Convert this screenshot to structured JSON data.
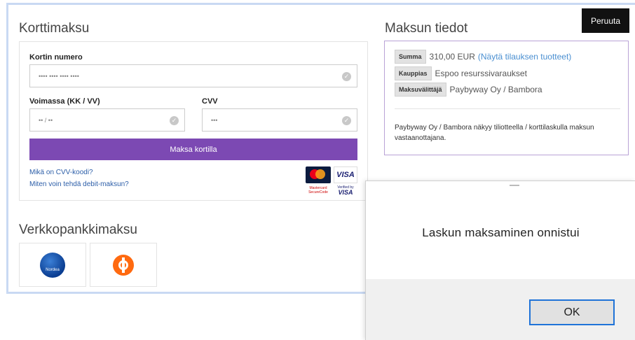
{
  "header": {
    "cancel_label": "Peruuta"
  },
  "card_payment": {
    "title": "Korttimaksu",
    "card_number_label": "Kortin numero",
    "card_number_placeholder": "•••• •••• •••• ••••",
    "expiry_label": "Voimassa (KK / VV)",
    "expiry_placeholder": "•• / ••",
    "cvv_label": "CVV",
    "cvv_placeholder": "•••",
    "pay_button": "Maksa kortilla",
    "link_cvv": "Mikä on CVV-koodi?",
    "link_debit": "Miten voin tehdä debit-maksun?",
    "logos": {
      "mastercard": "mastercard",
      "visa": "VISA",
      "mastercard_securecode": "Mastercard SecureCode",
      "verified_by": "Verified by",
      "verified_visa": "VISA"
    }
  },
  "bank_payment": {
    "title": "Verkkopankkimaksu",
    "banks": [
      {
        "name": "Nordea",
        "icon": "nordea-logo"
      },
      {
        "name": "OP",
        "icon": "op-logo"
      }
    ]
  },
  "payment_info": {
    "title": "Maksun tiedot",
    "sum_label": "Summa",
    "sum_value": "310,00 EUR",
    "sum_link": "(Näytä tilauksen tuotteet)",
    "merchant_label": "Kauppias",
    "merchant_value": "Espoo resurssivaraukset",
    "provider_label": "Maksuvälittäjä",
    "provider_value": "Paybyway Oy / Bambora",
    "note": "Paybyway Oy / Bambora näkyy tiliotteella / korttilaskulla maksun vastaanottajana."
  },
  "dialog": {
    "message": "Laskun maksaminen onnistui",
    "ok_label": "OK"
  },
  "colors": {
    "pay_button": "#7c49b3",
    "info_border": "#b9a3d6",
    "link": "#2c5ea8",
    "dialog_focus": "#1f73d8"
  }
}
